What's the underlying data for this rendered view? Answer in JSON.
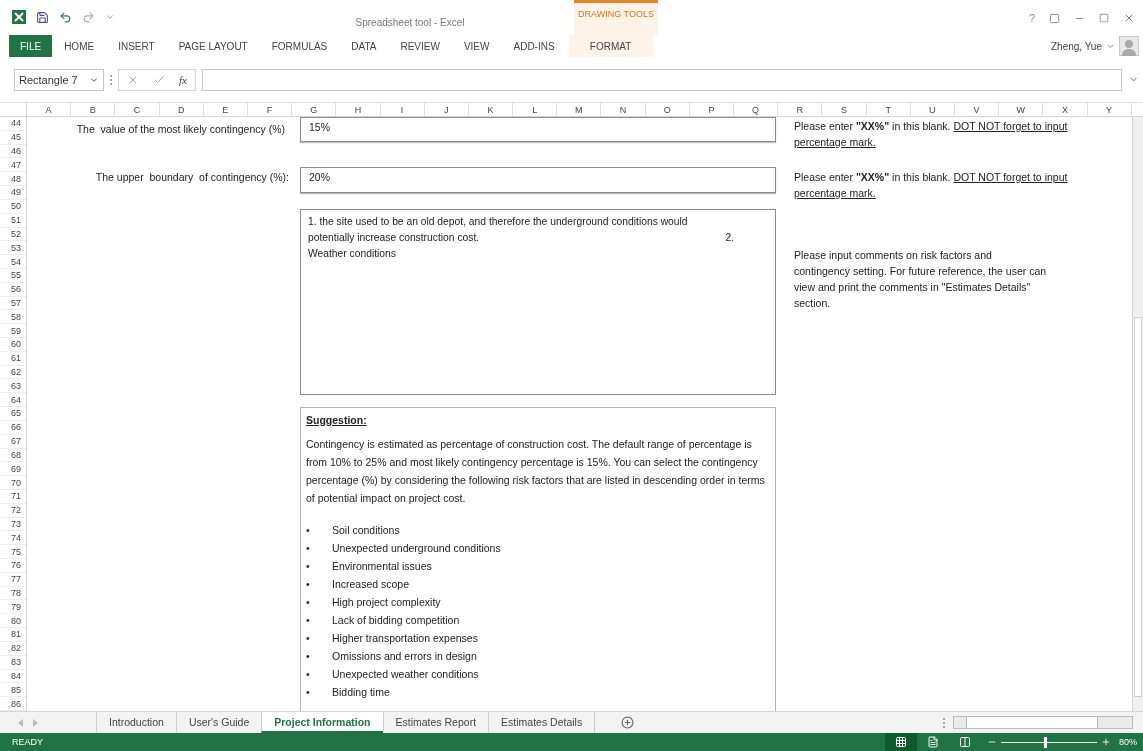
{
  "window": {
    "title": "Spreadsheet tool - Excel",
    "contextual_group": "DRAWING TOOLS",
    "help_label": "?"
  },
  "ribbon": {
    "tabs": [
      {
        "label": "FILE",
        "kind": "file"
      },
      {
        "label": "HOME",
        "kind": "tab"
      },
      {
        "label": "INSERT",
        "kind": "tab"
      },
      {
        "label": "PAGE LAYOUT",
        "kind": "tab"
      },
      {
        "label": "FORMULAS",
        "kind": "tab"
      },
      {
        "label": "DATA",
        "kind": "tab"
      },
      {
        "label": "REVIEW",
        "kind": "tab"
      },
      {
        "label": "VIEW",
        "kind": "tab"
      },
      {
        "label": "ADD-INS",
        "kind": "tab"
      },
      {
        "label": "FORMAT",
        "kind": "contextual"
      }
    ],
    "user": "Zheng, Yue"
  },
  "formula_bar": {
    "name_box": "Rectangle 7",
    "fx_label": "fx"
  },
  "sheet": {
    "columns": [
      "A",
      "B",
      "C",
      "D",
      "E",
      "F",
      "G",
      "H",
      "I",
      "J",
      "K",
      "L",
      "M",
      "N",
      "O",
      "P",
      "Q",
      "R",
      "S",
      "T",
      "U",
      "V",
      "W",
      "X",
      "Y"
    ],
    "rows": [
      "44",
      "45",
      "46",
      "47",
      "48",
      "49",
      "50",
      "51",
      "52",
      "53",
      "54",
      "55",
      "56",
      "57",
      "58",
      "59",
      "60",
      "61",
      "62",
      "63",
      "64",
      "65",
      "66",
      "67",
      "68",
      "69",
      "70",
      "71",
      "72",
      "73",
      "74",
      "75",
      "76",
      "77",
      "78",
      "79",
      "80",
      "81",
      "82",
      "83",
      "84",
      "85",
      "86"
    ],
    "fields": [
      {
        "label": "The  value of the most likely contingency (%)",
        "value": "15%",
        "note": "Please enter **\"XX%\"** in this blank.",
        "warning": "DOT NOT forget to input percentage mark."
      },
      {
        "label": "The upper  boundary  of contingency (%):",
        "value": "20%",
        "note": "Please enter **\"XX%\"** in this blank.",
        "warning": "DOT NOT forget to input percentage mark."
      }
    ],
    "comment": {
      "lines": [
        {
          "text": "1. the site used to be an old depot, and therefore the underground conditions would"
        },
        {
          "text": "potentially increase construction cost.",
          "trailing": "2."
        },
        {
          "text": "Weather conditions"
        }
      ],
      "note": "Please input comments on risk factors and contingency setting. For future reference, the user can view and print the comments in \"Estimates Details\" section."
    },
    "suggestion": {
      "heading": "Suggestion:",
      "paragraph": "Contingency is estimated as percentage of construction cost.  The default range of percentage is from 10% to 25% and most likely contingency percentage is 15%.  You can select the contingency percentage (%) by considering the following risk factors that are listed in descending order in terms of potential impact on project cost.",
      "bullet": "•",
      "items": [
        "Soil conditions",
        "Unexpected underground conditions",
        "Environmental issues",
        "Increased scope",
        "High project complexity",
        "Lack of bidding competition",
        "Higher transportation expenses",
        "Omissions and errors in design",
        "Unexpected weather conditions",
        "Bidding time"
      ]
    }
  },
  "sheet_tabs": [
    {
      "label": "Introduction",
      "selected": false
    },
    {
      "label": "User's Guide",
      "selected": false
    },
    {
      "label": "Project Information",
      "selected": true
    },
    {
      "label": "Estimates Report",
      "selected": false
    },
    {
      "label": "Estimates Details",
      "selected": false
    }
  ],
  "status_bar": {
    "status": "READY",
    "views": [
      {
        "kind": "normal",
        "selected": true
      },
      {
        "kind": "page-layout",
        "selected": false
      },
      {
        "kind": "page-break",
        "selected": false
      }
    ],
    "zoom": {
      "level": 0.46,
      "reading": "80%"
    }
  }
}
